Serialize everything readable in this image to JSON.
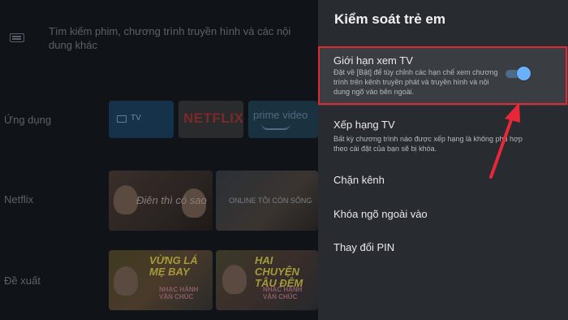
{
  "background": {
    "search_placeholder": "Tìm kiếm phim, chương trình truyền hình và các nội dung khác",
    "rows": {
      "apps_label": "Ứng dụng",
      "netflix_label": "Netflix",
      "suggested_label": "Đề xuất"
    },
    "apps": {
      "tv_label": "TV",
      "netflix_label": "NETFLIX",
      "prime_label": "prime video"
    },
    "netflix_thumbs": {
      "m1_title": "Điên thì có sao",
      "m2_title": "ONLINE TÔI CÒN SỐNG"
    },
    "suggested_thumbs": {
      "s1_title": "VỪNG LÁ MẸ BAY",
      "s1_sub": "NHẠC HÀNH VẬN CHÚC",
      "s2_title": "HAI CHUYỆN TÂU ĐÊM",
      "s2_sub": "NHẠC HÀNH VẬN CHÚC"
    }
  },
  "panel": {
    "title": "Kiểm soát trẻ em",
    "items": [
      {
        "title": "Giới hạn xem TV",
        "description": "Đặt về [Bật] để tùy chỉnh các hạn chế xem chương trình trên kênh truyền phát và truyền hình và nội dung ngõ vào bên ngoài.",
        "toggle_on": true
      },
      {
        "title": "Xếp hạng TV",
        "description": "Bất kỳ chương trình nào được xếp hạng là không phù hợp theo cài đặt của bạn sẽ bị khóa."
      },
      {
        "title": "Chặn kênh"
      },
      {
        "title": "Khóa ngõ ngoài vào"
      },
      {
        "title": "Thay đổi PIN"
      }
    ]
  },
  "colors": {
    "panel_bg": "#282b2f",
    "selected_bg": "#3a3e43",
    "highlight": "#e02a33",
    "toggle_thumb": "#6ab0ff",
    "annotation_arrow": "#e8283a"
  }
}
